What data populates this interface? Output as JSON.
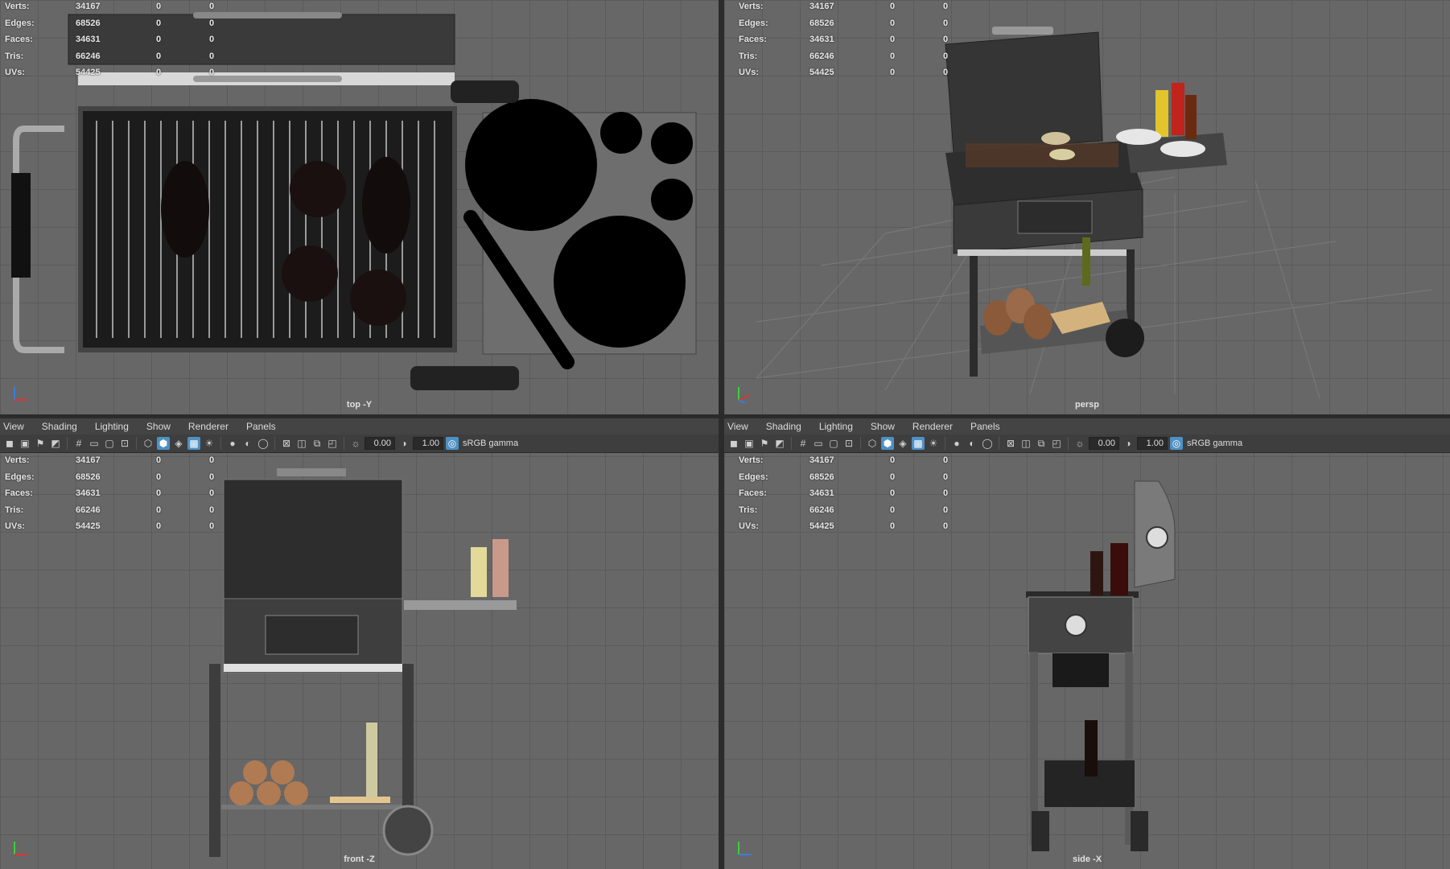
{
  "stats": {
    "rows": [
      {
        "label": "Verts:",
        "value": "34167",
        "c2": "0",
        "c3": "0"
      },
      {
        "label": "Edges:",
        "value": "68526",
        "c2": "0",
        "c3": "0"
      },
      {
        "label": "Faces:",
        "value": "34631",
        "c2": "0",
        "c3": "0"
      },
      {
        "label": "Tris:",
        "value": "66246",
        "c2": "0",
        "c3": "0"
      },
      {
        "label": "UVs:",
        "value": "54425",
        "c2": "0",
        "c3": "0"
      }
    ]
  },
  "menu": [
    "View",
    "Shading",
    "Lighting",
    "Show",
    "Renderer",
    "Panels"
  ],
  "toolbar": {
    "exposure": "0.00",
    "gamma": "1.00",
    "color_space": "sRGB gamma"
  },
  "viewports": {
    "top": {
      "camera": "top -Y"
    },
    "persp": {
      "camera": "persp"
    },
    "front": {
      "camera": "front -Z"
    },
    "side": {
      "camera": "side -X"
    }
  },
  "colors": {
    "viewport_bg": "#676767",
    "grid": "#5b5b5b",
    "active_icon": "#4e90c2"
  }
}
